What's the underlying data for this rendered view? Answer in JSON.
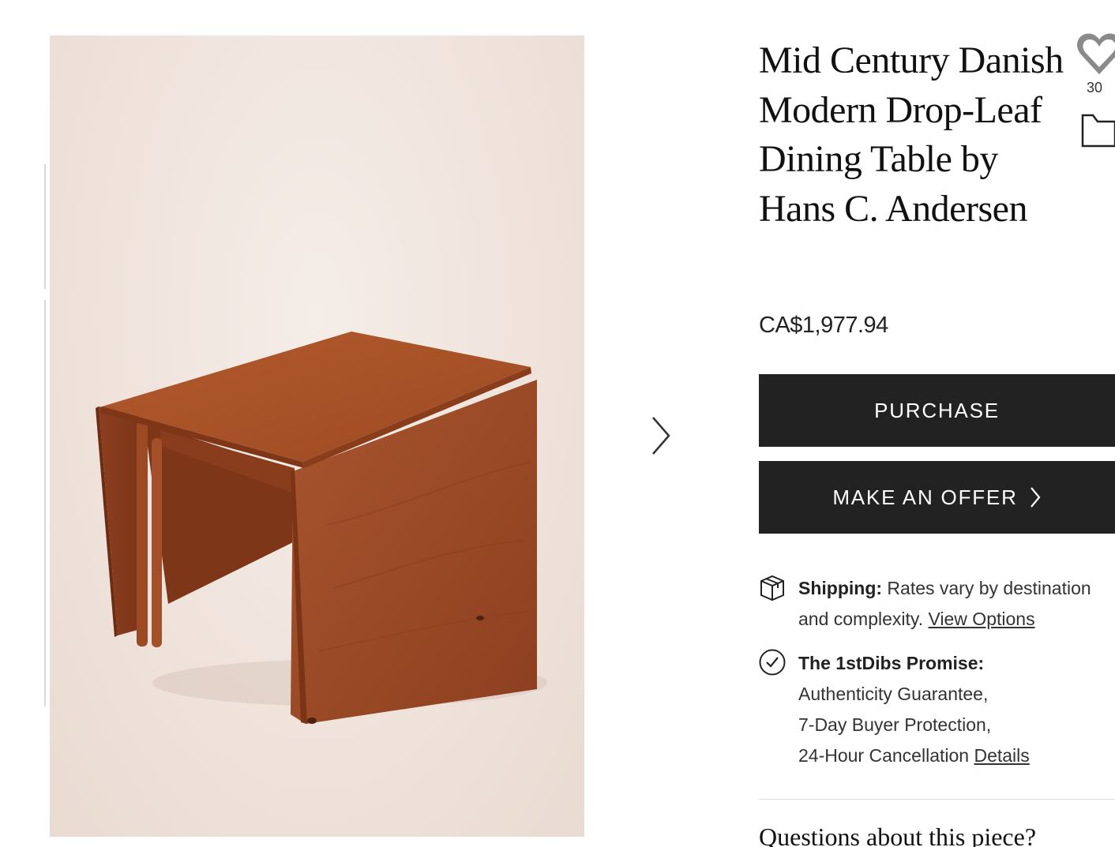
{
  "product": {
    "title": "Mid Century Danish Modern Drop-Leaf Dining Table by Hans C. Andersen",
    "price": "CA$1,977.94",
    "favorites_count": "30",
    "image_alt": "Teak drop-leaf dining table"
  },
  "actions": {
    "purchase_label": "PURCHASE",
    "offer_label": "MAKE AN OFFER"
  },
  "shipping": {
    "label": "Shipping:",
    "text": "Rates vary by destination and complexity.",
    "link": "View Options"
  },
  "promise": {
    "label": "The 1stDibs Promise:",
    "line1": "Authenticity Guarantee,",
    "line2": "7-Day Buyer Protection,",
    "line3": "24-Hour Cancellation",
    "link": "Details"
  },
  "questions_heading": "Questions about this piece?",
  "icons": {
    "favorite": "heart-icon",
    "save": "folder-icon",
    "next": "chevron-right-icon",
    "shipping": "box-icon",
    "promise": "check-circle-icon"
  },
  "colors": {
    "button_bg": "#222222",
    "button_text": "#ffffff",
    "wood": "#a5522c",
    "backdrop": "#efe3dc"
  }
}
